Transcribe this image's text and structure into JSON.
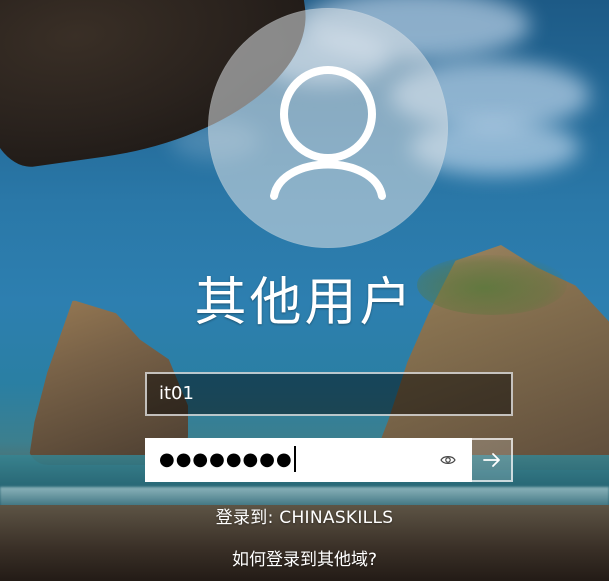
{
  "login": {
    "display_name": "其他用户",
    "username_value": "it01",
    "password_mask": "●●●●●●●●",
    "signin_to": "登录到: CHINASKILLS",
    "other_domain_link": "如何登录到其他域?"
  },
  "icons": {
    "avatar": "user-silhouette",
    "reveal": "eye-icon",
    "submit": "arrow-right-icon"
  }
}
